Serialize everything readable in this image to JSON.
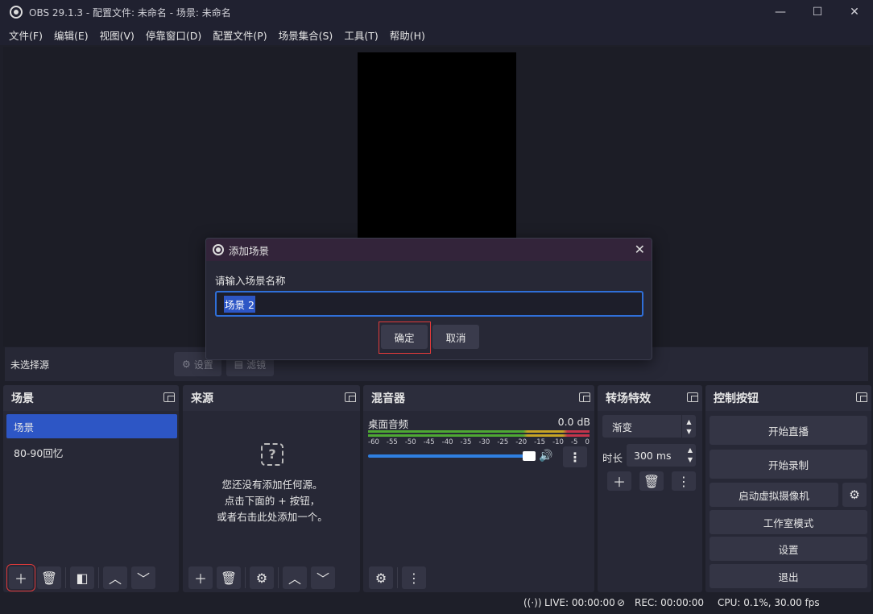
{
  "window": {
    "title": "OBS 29.1.3 - 配置文件: 未命名 - 场景: 未命名",
    "minimize": "—",
    "maximize": "☐",
    "close": "✕"
  },
  "menu": [
    "文件(F)",
    "编辑(E)",
    "视图(V)",
    "停靠窗口(D)",
    "配置文件(P)",
    "场景集合(S)",
    "工具(T)",
    "帮助(H)"
  ],
  "source_toolbar": {
    "no_source": "未选择源",
    "settings": "设置",
    "filters": "滤镜"
  },
  "scenes": {
    "title": "场景",
    "items": [
      "场景",
      "80-90回忆"
    ],
    "selected_index": 0
  },
  "sources": {
    "title": "来源",
    "empty_line1": "您还没有添加任何源。",
    "empty_line2": "点击下面的 + 按钮，",
    "empty_line3": "或者右击此处添加一个。"
  },
  "mixer": {
    "title": "混音器",
    "channel": "桌面音频",
    "level": "0.0 dB",
    "ticks": [
      "-60",
      "-55",
      "-50",
      "-45",
      "-40",
      "-35",
      "-30",
      "-25",
      "-20",
      "-15",
      "-10",
      "-5",
      "0"
    ],
    "volume_fraction": 1.0
  },
  "transitions": {
    "title": "转场特效",
    "selected": "渐变",
    "duration_label": "时长",
    "duration_value": "300 ms"
  },
  "controls": {
    "title": "控制按钮",
    "start_stream": "开始直播",
    "start_record": "开始录制",
    "virtual_cam": "启动虚拟摄像机",
    "studio_mode": "工作室模式",
    "settings": "设置",
    "exit": "退出"
  },
  "status": {
    "live": "LIVE: 00:00:00",
    "rec": "REC: 00:00:00",
    "cpu": "CPU: 0.1%, 30.00 fps"
  },
  "dialog": {
    "title": "添加场景",
    "prompt": "请输入场景名称",
    "value": "场景 2",
    "ok": "确定",
    "cancel": "取消"
  }
}
